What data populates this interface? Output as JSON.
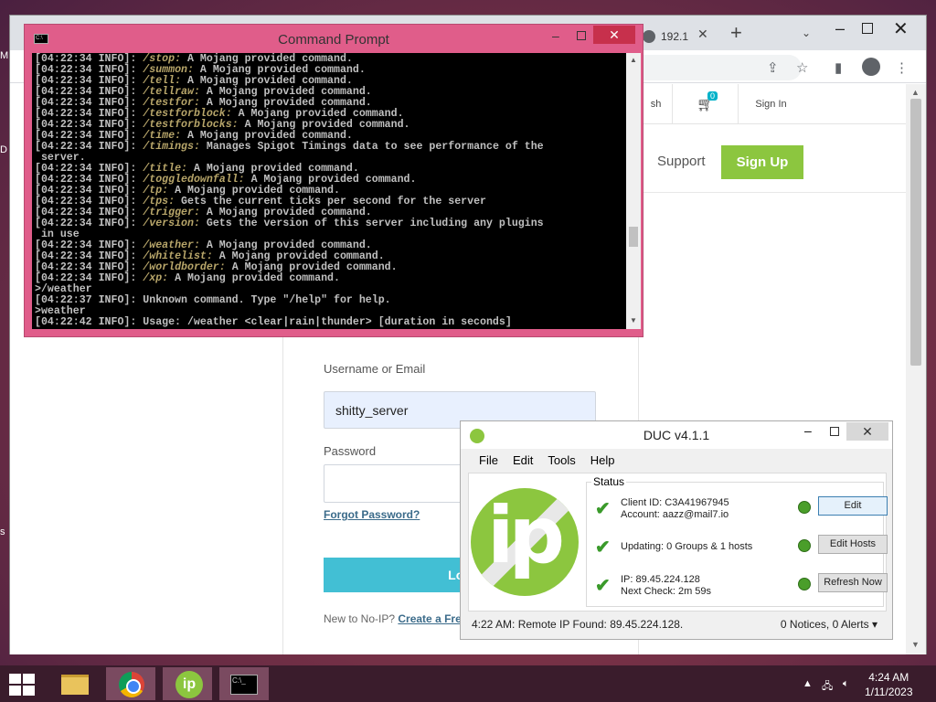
{
  "desktop": {
    "edge_letters": [
      "M",
      "D",
      "s"
    ]
  },
  "browser": {
    "tab": {
      "title": "192.1"
    },
    "header": {
      "search_fragment": "sh",
      "cart_count": "0",
      "sign_in": "Sign In"
    },
    "nav": {
      "support": "Support",
      "sign_up": "Sign Up"
    },
    "login": {
      "username_label": "Username or Email",
      "username_value": "shitty_server",
      "password_label": "Password",
      "forgot": "Forgot Password?",
      "login_button": "Log",
      "new_prefix": "New to No-IP?",
      "create_link": "Create a Free"
    }
  },
  "cmd": {
    "title": "Command Prompt",
    "lines": [
      {
        "p": "[04:22:34 INFO]: ",
        "c": "/stop:",
        "t": " A Mojang provided command."
      },
      {
        "p": "[04:22:34 INFO]: ",
        "c": "/summon:",
        "t": " A Mojang provided command."
      },
      {
        "p": "[04:22:34 INFO]: ",
        "c": "/tell:",
        "t": " A Mojang provided command."
      },
      {
        "p": "[04:22:34 INFO]: ",
        "c": "/tellraw:",
        "t": " A Mojang provided command."
      },
      {
        "p": "[04:22:34 INFO]: ",
        "c": "/testfor:",
        "t": " A Mojang provided command."
      },
      {
        "p": "[04:22:34 INFO]: ",
        "c": "/testforblock:",
        "t": " A Mojang provided command."
      },
      {
        "p": "[04:22:34 INFO]: ",
        "c": "/testforblocks:",
        "t": " A Mojang provided command."
      },
      {
        "p": "[04:22:34 INFO]: ",
        "c": "/time:",
        "t": " A Mojang provided command."
      },
      {
        "p": "[04:22:34 INFO]: ",
        "c": "/timings:",
        "t": " Manages Spigot Timings data to see performance of the"
      },
      {
        "p": " server.",
        "c": "",
        "t": ""
      },
      {
        "p": "[04:22:34 INFO]: ",
        "c": "/title:",
        "t": " A Mojang provided command."
      },
      {
        "p": "[04:22:34 INFO]: ",
        "c": "/toggledownfall:",
        "t": " A Mojang provided command."
      },
      {
        "p": "[04:22:34 INFO]: ",
        "c": "/tp:",
        "t": " A Mojang provided command."
      },
      {
        "p": "[04:22:34 INFO]: ",
        "c": "/tps:",
        "t": " Gets the current ticks per second for the server"
      },
      {
        "p": "[04:22:34 INFO]: ",
        "c": "/trigger:",
        "t": " A Mojang provided command."
      },
      {
        "p": "[04:22:34 INFO]: ",
        "c": "/version:",
        "t": " Gets the version of this server including any plugins"
      },
      {
        "p": " in use",
        "c": "",
        "t": ""
      },
      {
        "p": "[04:22:34 INFO]: ",
        "c": "/weather:",
        "t": " A Mojang provided command."
      },
      {
        "p": "[04:22:34 INFO]: ",
        "c": "/whitelist:",
        "t": " A Mojang provided command."
      },
      {
        "p": "[04:22:34 INFO]: ",
        "c": "/worldborder:",
        "t": " A Mojang provided command."
      },
      {
        "p": "[04:22:34 INFO]: ",
        "c": "/xp:",
        "t": " A Mojang provided command."
      },
      {
        "p": ">/weather",
        "c": "",
        "t": ""
      },
      {
        "p": "[04:22:37 INFO]: Unknown command. Type \"/help\" for help.",
        "c": "",
        "t": ""
      },
      {
        "p": ">weather",
        "c": "",
        "t": ""
      },
      {
        "p": "[04:22:42 INFO]: Usage: /weather <clear|rain|thunder> [duration in seconds]",
        "c": "",
        "t": ""
      }
    ]
  },
  "duc": {
    "title": "DUC v4.1.1",
    "menu": [
      "File",
      "Edit",
      "Tools",
      "Help"
    ],
    "status_legend": "Status",
    "rows": [
      {
        "line1": "Client ID: C3A41967945",
        "line2": "Account: aazz@mail7.io",
        "button": "Edit"
      },
      {
        "line1": "Updating: 0 Groups & 1 hosts",
        "line2": "",
        "button": "Edit Hosts"
      },
      {
        "line1": "IP: 89.45.224.128",
        "line2": "Next Check: 2m 59s",
        "button": "Refresh Now"
      }
    ],
    "statusbar_left": "4:22 AM: Remote IP Found: 89.45.224.128.",
    "statusbar_right": "0 Notices, 0 Alerts"
  },
  "taskbar": {
    "time": "4:24 AM",
    "date": "1/11/2023"
  }
}
